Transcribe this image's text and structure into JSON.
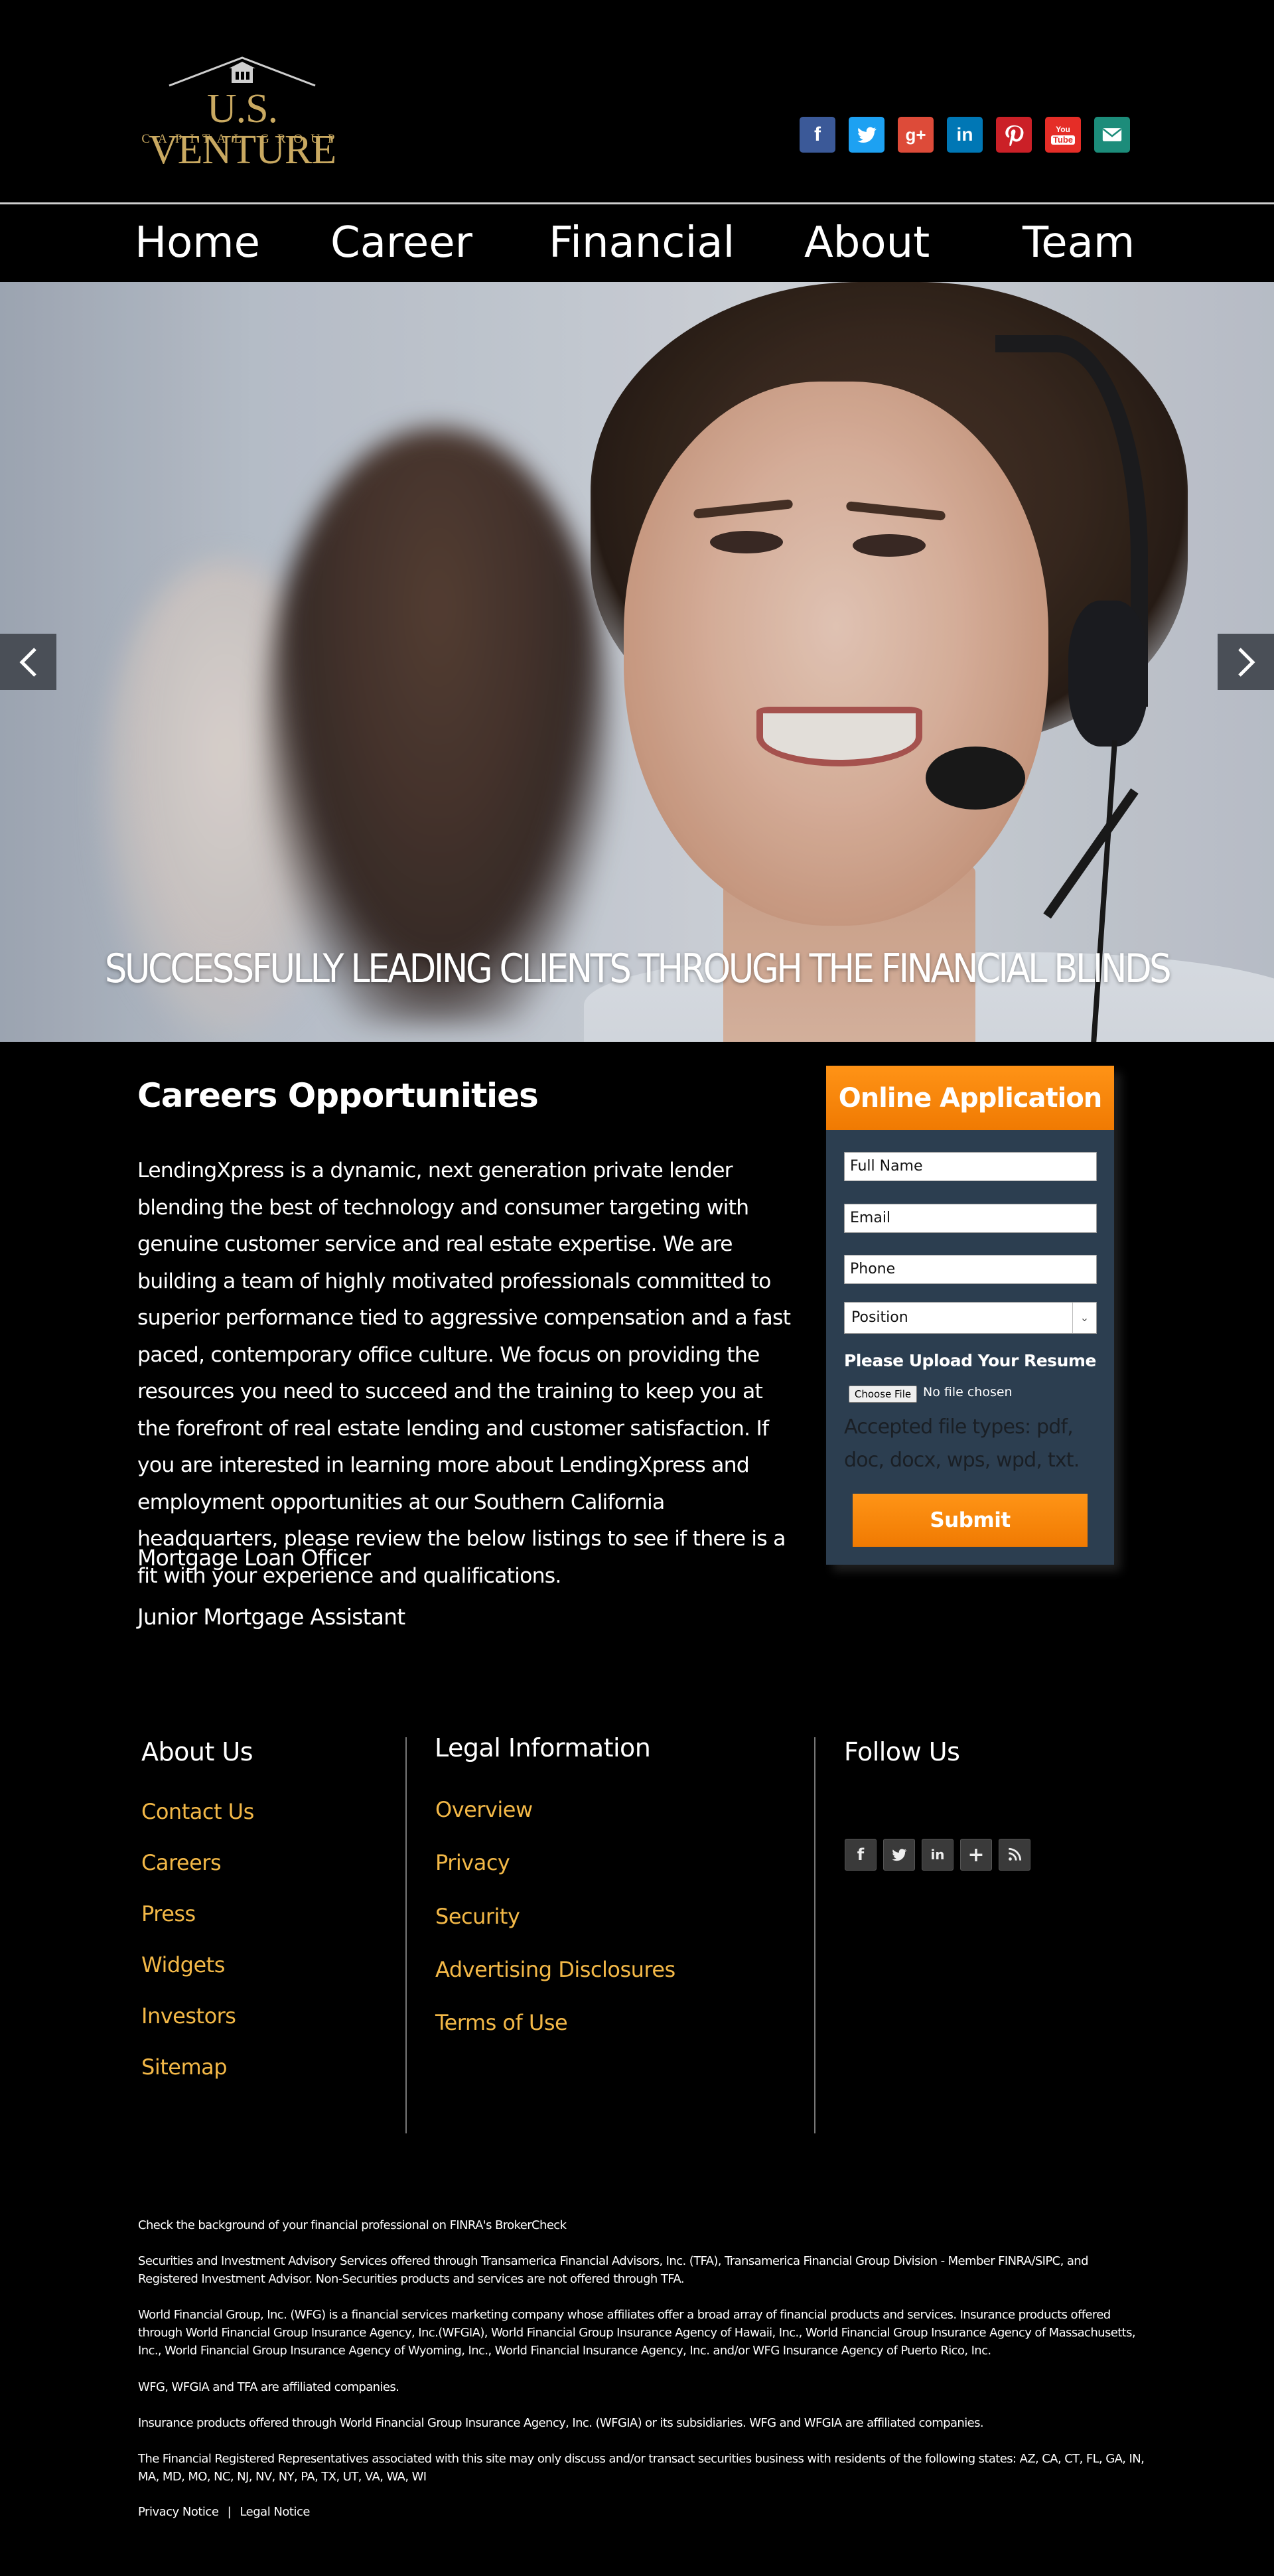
{
  "brand": {
    "name": "U.S. VENTURE",
    "tagline": "CAPITAL GROUP",
    "color": "#c9a961"
  },
  "social_top": [
    {
      "icon": "facebook-icon",
      "color": "#3b5998",
      "glyph": "f"
    },
    {
      "icon": "twitter-icon",
      "color": "#1da1f2",
      "glyph": "t"
    },
    {
      "icon": "google-plus-icon",
      "color": "#dd4b39",
      "glyph": "g+"
    },
    {
      "icon": "linkedin-icon",
      "color": "#0077b5",
      "glyph": "in"
    },
    {
      "icon": "pinterest-icon",
      "color": "#cb2027",
      "glyph": "p"
    },
    {
      "icon": "youtube-icon",
      "color": "#e52d27",
      "glyph": "You Tube"
    },
    {
      "icon": "email-icon",
      "color": "#1c8c7a",
      "glyph": "mail"
    }
  ],
  "nav": {
    "home": "Home",
    "career": "Career",
    "financial": "Financial",
    "about": "About",
    "team": "Team"
  },
  "hero": {
    "caption": "SUCCESSFULLY LEADING CLIENTS THROUGH THE FINANCIAL BLINDS"
  },
  "careers": {
    "title": "Careers Opportunities",
    "body": "LendingXpress is a dynamic, next generation private lender blending the best of technology and consumer targeting with genuine customer service and real estate expertise. We are building a team of highly motivated professionals committed to superior performance tied to aggressive compensation and a fast paced, contemporary office culture. We focus on providing the resources you need to succeed and the training to keep you at the forefront of real estate lending and customer satisfaction. If you are interested in learning more about LendingXpress and employment opportunities at our Southern California headquarters, please review the below listings to see if there is a fit with your experience and qualifications.",
    "jobs": [
      "Mortgage Loan Officer",
      "Junior Mortgage Assistant"
    ]
  },
  "application": {
    "title": "Online Application",
    "full_name": "Full Name",
    "email": "Email",
    "phone": "Phone",
    "position": "Position",
    "upload_label": "Please Upload Your Resume",
    "choose_file": "Choose File",
    "no_file": "No file chosen",
    "accepted": "Accepted file types: pdf, doc, docx, wps, wpd, txt.",
    "submit": "Submit",
    "accent": "#f38a0a"
  },
  "footer": {
    "about": {
      "title": "About Us",
      "links": [
        "Contact Us",
        "Careers",
        "Press",
        "Widgets",
        "Investors",
        "Sitemap"
      ]
    },
    "legal": {
      "title": "Legal Information",
      "links": [
        "Overview",
        "Privacy",
        "Security",
        "Advertising Disclosures",
        "Terms of Use"
      ]
    },
    "follow": {
      "title": "Follow Us",
      "icons": [
        "facebook-icon",
        "twitter-icon",
        "linkedin-icon",
        "plus-icon",
        "rss-icon"
      ]
    },
    "link_color": "#f3b847"
  },
  "disclosures": {
    "p1": "Check the background of your financial professional on FINRA's BrokerCheck",
    "p2": "Securities and Investment Advisory Services offered through Transamerica Financial Advisors, Inc. (TFA), Transamerica Financial Group Division - Member FINRA/SIPC, and Registered Investment Advisor. Non-Securities products and services are not offered through TFA.",
    "p3": "World Financial Group, Inc. (WFG) is a financial services marketing company whose affiliates offer a broad array of financial products and services. Insurance products offered through World Financial Group Insurance Agency, Inc.(WFGIA), World Financial Group Insurance Agency of Hawaii, Inc., World Financial Group Insurance Agency of Massachusetts, Inc., World Financial Group Insurance Agency of Wyoming, Inc., World Financial Insurance Agency, Inc. and/or WFG Insurance Agency of Puerto Rico, Inc.",
    "p4": "WFG, WFGIA and TFA are affiliated companies.",
    "p5": "Insurance products offered through World Financial Group Insurance Agency, Inc. (WFGIA) or its subsidiaries. WFG and WFGIA are affiliated companies.",
    "p6": "The Financial Registered Representatives associated with this site may only discuss and/or transact securities business with residents of the following states: AZ, CA, CT, FL, GA, IN, MA, MD, MO, NC, NJ, NV, NY, PA, TX, UT, VA, WA, WI",
    "privacy": "Privacy Notice",
    "separator": "|",
    "legal_notice": "Legal Notice"
  }
}
